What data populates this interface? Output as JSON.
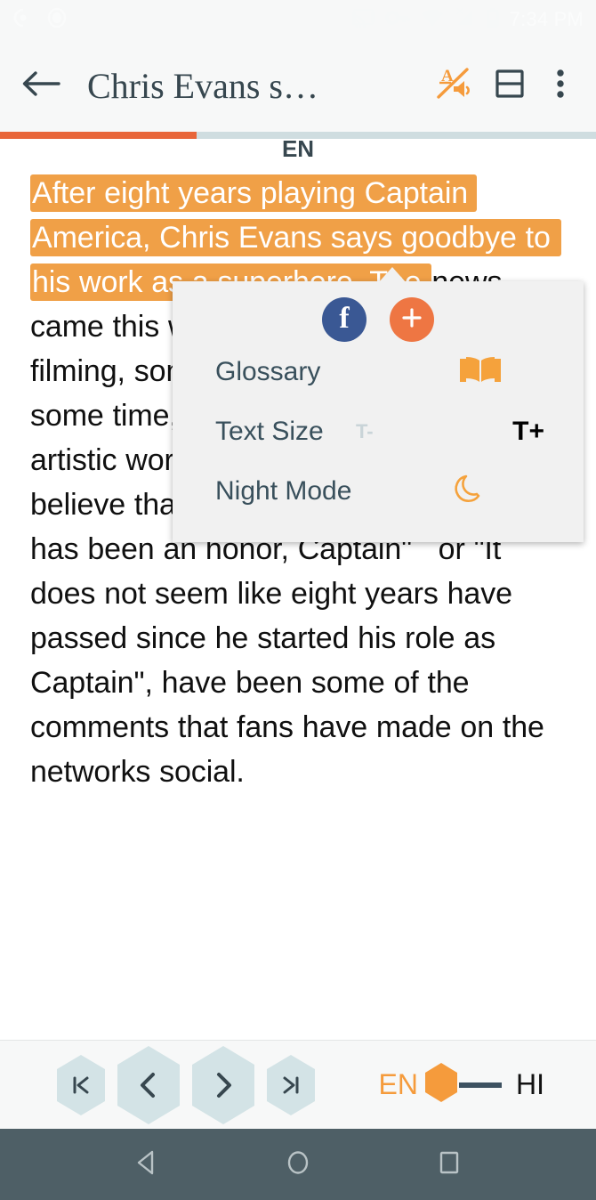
{
  "status_bar": {
    "time": "7:34 PM",
    "left_icons": [
      "notification-circle-icon",
      "notification-oval-icon"
    ],
    "right_icons": [
      "cast-icon",
      "vpn-key-icon",
      "wifi-icon",
      "cell-signal-off-icon",
      "battery-icon"
    ]
  },
  "app_bar": {
    "back_icon": "back-arrow-icon",
    "title": "Chris Evans s…",
    "tts_icon": "text-to-speech-mute-icon",
    "split_view_icon": "split-view-icon",
    "overflow_icon": "overflow-menu-icon"
  },
  "progress": {
    "percent": 33,
    "fill_color": "#e8663a",
    "track_color": "#cfdde0"
  },
  "reader": {
    "language_label": "EN",
    "highlighted_text": "After eight years playing Captain America, Chris Evans says goodbye to his work as a superhero. The ",
    "body_text": "news came this week after the actor finished filming, something that was known for some time, but the news has taken the artistic world by surprise.   \"It's hard to believe that this moment came\",    \"It has been an honor, Captain\"   or \"It does not seem like eight years have passed since he started his role as Captain\", have been some of the comments that fans have made on the networks social."
  },
  "menu": {
    "share": {
      "facebook_label": "f",
      "facebook_name": "facebook-share-button",
      "facebook_color": "#3a5894",
      "add_label": "+",
      "add_name": "add-button",
      "add_color": "#ee7643"
    },
    "items": [
      {
        "label": "Glossary",
        "icon": "open-book-icon"
      },
      {
        "label": "Text Size",
        "icon": "text-size-icon",
        "decrease_label": "T-",
        "increase_label": "T+"
      },
      {
        "label": "Night Mode",
        "icon": "crescent-moon-icon"
      }
    ]
  },
  "bottom_bar": {
    "pager": [
      {
        "name": "first-page-button",
        "icon": "skip-to-start-icon"
      },
      {
        "name": "previous-page-button",
        "icon": "chevron-left-icon"
      },
      {
        "name": "next-page-button",
        "icon": "chevron-right-icon"
      },
      {
        "name": "last-page-button",
        "icon": "skip-to-end-icon"
      }
    ],
    "language_toggle": {
      "left_label": "EN",
      "right_label": "HI",
      "active": "EN",
      "knob_color": "#f59b3c"
    }
  },
  "android_nav": {
    "back": "android-back-icon",
    "home": "android-home-icon",
    "recents": "android-recents-icon"
  },
  "colors": {
    "accent_orange": "#f59b3c",
    "highlight_orange": "#f0a047",
    "progress_orange": "#e8663a",
    "slate": "#37474f",
    "hex_fill": "#d3e3e6"
  }
}
